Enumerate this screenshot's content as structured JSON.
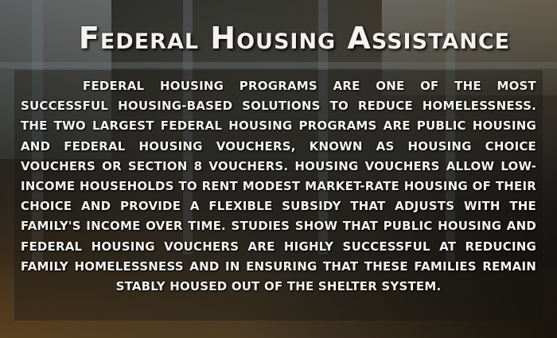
{
  "poster": {
    "title": "Federal Housing Assistance",
    "body": "Federal housing programs are one of the most successful housing-based solutions to reduce homelessness. The two largest federal housing programs are public housing and federal housing vouchers, known as Housing Choice Vouchers or Section 8 vouchers. Housing vouchers allow low-income households to rent modest market-rate housing of their choice and provide a flexible subsidy that adjusts with the family's income over time. Studies show that public housing and federal housing vouchers are highly successful at reducing family homelessness and in ensuring that these families remain stably housed out of the shelter system."
  },
  "colors": {
    "text": "#f6f4f0",
    "background": "#3a3934"
  }
}
